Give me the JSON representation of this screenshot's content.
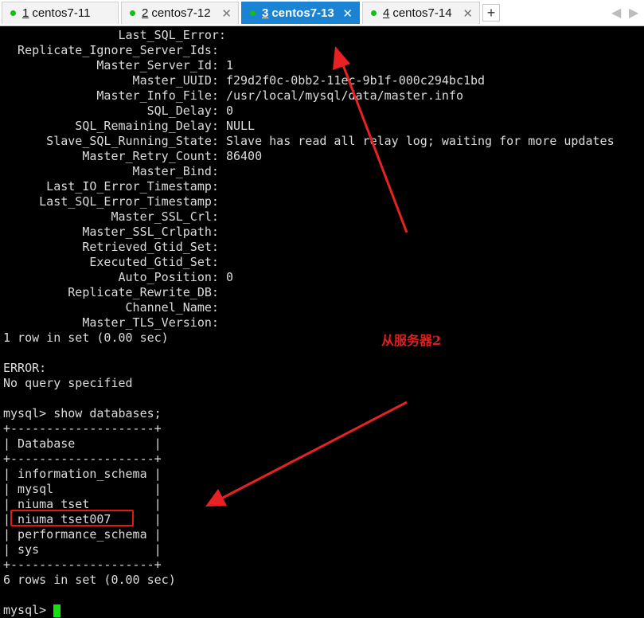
{
  "tabs": [
    {
      "number": "1",
      "label": "centos7-11",
      "status_color": "#11c011",
      "active": false
    },
    {
      "number": "2",
      "label": "centos7-12",
      "status_color": "#11c011",
      "active": false
    },
    {
      "number": "3",
      "label": "centos7-13",
      "status_color": "#11c011",
      "active": true
    },
    {
      "number": "4",
      "label": "centos7-14",
      "status_color": "#11c011",
      "active": false
    }
  ],
  "tab_close_glyph": "✕",
  "tab_add_glyph": "+",
  "nav": {
    "prev": "◀",
    "next": "▶"
  },
  "terminal": {
    "lines": [
      "                Last_SQL_Error:",
      "  Replicate_Ignore_Server_Ids:",
      "             Master_Server_Id: 1",
      "                  Master_UUID: f29d2f0c-0bb2-11ec-9b1f-000c294bc1bd",
      "             Master_Info_File: /usr/local/mysql/data/master.info",
      "                    SQL_Delay: 0",
      "          SQL_Remaining_Delay: NULL",
      "      Slave_SQL_Running_State: Slave has read all relay log; waiting for more updates",
      "           Master_Retry_Count: 86400",
      "                  Master_Bind:",
      "      Last_IO_Error_Timestamp:",
      "     Last_SQL_Error_Timestamp:",
      "               Master_SSL_Crl:",
      "           Master_SSL_Crlpath:",
      "           Retrieved_Gtid_Set:",
      "            Executed_Gtid_Set:",
      "                Auto_Position: 0",
      "         Replicate_Rewrite_DB:",
      "                 Channel_Name:",
      "           Master_TLS_Version:",
      "1 row in set (0.00 sec)",
      "",
      "ERROR:",
      "No query specified",
      "",
      "mysql> show databases;",
      "+--------------------+",
      "| Database           |",
      "+--------------------+",
      "| information_schema |",
      "| mysql              |",
      "| niuma_tset         |",
      "| niuma_tset007      |",
      "| performance_schema |",
      "| sys                |",
      "+--------------------+",
      "6 rows in set (0.00 sec)",
      "",
      "mysql> "
    ],
    "cursor_color": "#13e313"
  },
  "annotation": {
    "label": "从服务器2",
    "color": "#e02020"
  }
}
